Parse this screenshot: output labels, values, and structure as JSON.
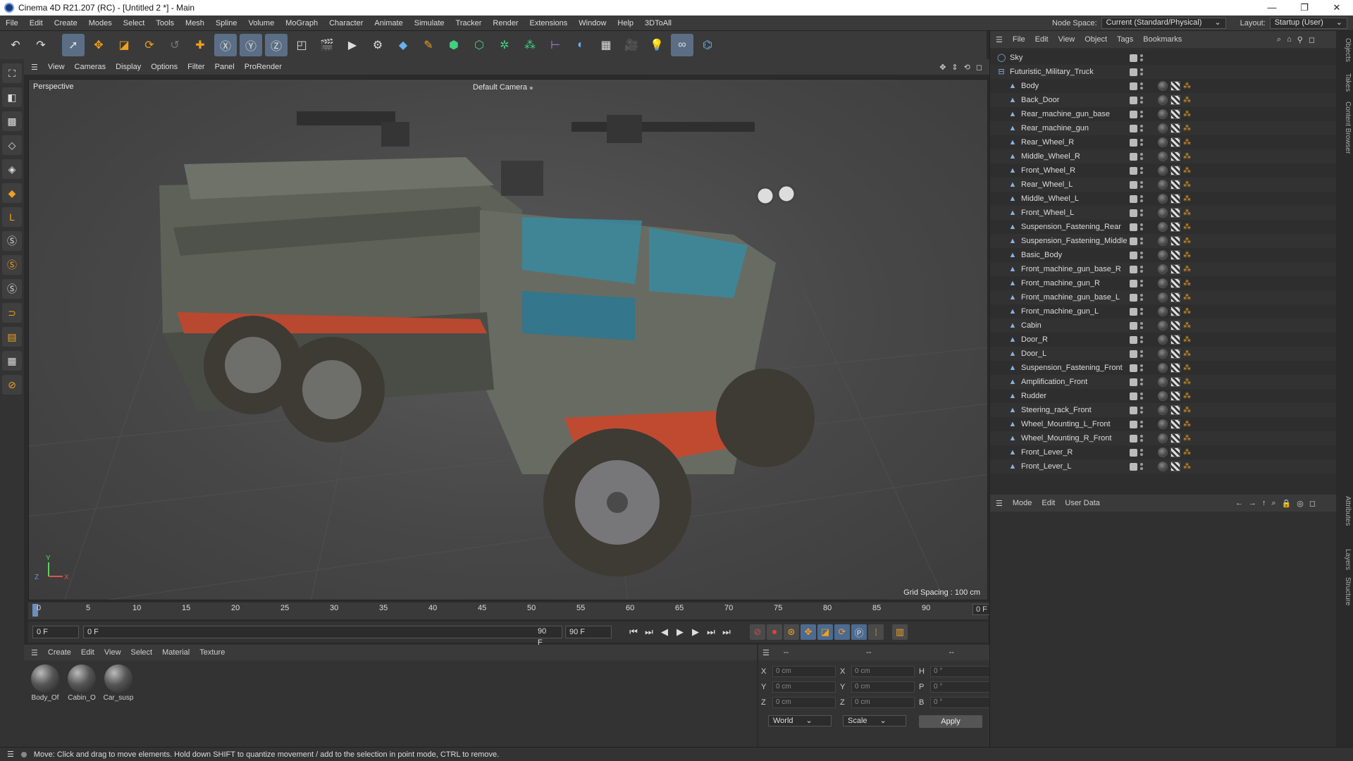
{
  "window": {
    "title": "Cinema 4D R21.207 (RC) - [Untitled 2 *] - Main",
    "min": "—",
    "max": "❐",
    "close": "✕"
  },
  "menu": [
    "File",
    "Edit",
    "Create",
    "Modes",
    "Select",
    "Tools",
    "Mesh",
    "Spline",
    "Volume",
    "MoGraph",
    "Character",
    "Animate",
    "Simulate",
    "Tracker",
    "Render",
    "Extensions",
    "Window",
    "Help",
    "3DToAll"
  ],
  "nodespace": {
    "label": "Node Space:",
    "value": "Current (Standard/Physical)"
  },
  "layout": {
    "label": "Layout:",
    "value": "Startup (User)"
  },
  "viewport": {
    "menu": [
      "View",
      "Cameras",
      "Display",
      "Options",
      "Filter",
      "Panel",
      "ProRender"
    ],
    "label": "Perspective",
    "camera": "Default Camera",
    "grid_spacing": "Grid Spacing : 100 cm"
  },
  "timeline": {
    "ticks": [
      "0",
      "5",
      "10",
      "15",
      "20",
      "25",
      "30",
      "35",
      "40",
      "45",
      "50",
      "55",
      "60",
      "65",
      "70",
      "75",
      "80",
      "85",
      "90"
    ],
    "current": "0 F"
  },
  "transport": {
    "start": "0 F",
    "scrub": "0 F",
    "end1": "90 F",
    "end2": "90 F"
  },
  "materials": {
    "menu": [
      "Create",
      "Edit",
      "View",
      "Select",
      "Material",
      "Texture"
    ],
    "items": [
      "Body_Of",
      "Cabin_O",
      "Car_susp"
    ]
  },
  "coords": {
    "rows": [
      {
        "a": "X",
        "av": "0 cm",
        "b": "X",
        "bv": "0 cm",
        "c": "H",
        "cv": "0 °"
      },
      {
        "a": "Y",
        "av": "0 cm",
        "b": "Y",
        "bv": "0 cm",
        "c": "P",
        "cv": "0 °"
      },
      {
        "a": "Z",
        "av": "0 cm",
        "b": "Z",
        "bv": "0 cm",
        "c": "B",
        "cv": "0 °"
      }
    ],
    "world": "World",
    "scale": "Scale",
    "apply": "Apply",
    "header": "--"
  },
  "objects": {
    "menu": [
      "File",
      "Edit",
      "View",
      "Object",
      "Tags",
      "Bookmarks"
    ],
    "items": [
      "Sky",
      "Futuristic_Military_Truck",
      "Body",
      "Back_Door",
      "Rear_machine_gun_base",
      "Rear_machine_gun",
      "Rear_Wheel_R",
      "Middle_Wheel_R",
      "Front_Wheel_R",
      "Rear_Wheel_L",
      "Middle_Wheel_L",
      "Front_Wheel_L",
      "Suspension_Fastening_Rear",
      "Suspension_Fastening_Middle",
      "Basic_Body",
      "Front_machine_gun_base_R",
      "Front_machine_gun_R",
      "Front_machine_gun_base_L",
      "Front_machine_gun_L",
      "Cabin",
      "Door_R",
      "Door_L",
      "Suspension_Fastening_Front",
      "Amplification_Front",
      "Rudder",
      "Steering_rack_Front",
      "Wheel_Mounting_L_Front",
      "Wheel_Mounting_R_Front",
      "Front_Lever_R",
      "Front_Lever_L"
    ]
  },
  "attributes": {
    "menu": [
      "Mode",
      "Edit",
      "User Data"
    ]
  },
  "side_tabs": [
    "Objects",
    "Takes",
    "Content Browser",
    "Attributes",
    "Layers",
    "Structure"
  ],
  "status": "Move: Click and drag to move elements. Hold down SHIFT to quantize movement / add to the selection in point mode, CTRL to remove."
}
